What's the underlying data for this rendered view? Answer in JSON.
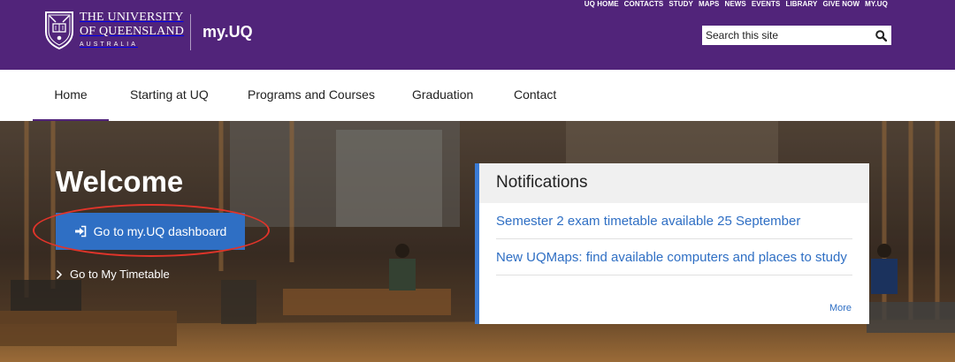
{
  "header": {
    "utility_links": [
      "UQ HOME",
      "CONTACTS",
      "STUDY",
      "MAPS",
      "NEWS",
      "EVENTS",
      "LIBRARY",
      "GIVE NOW",
      "MY.UQ"
    ],
    "logo": {
      "line1": "THE UNIVERSITY",
      "line2": "OF QUEENSLAND",
      "line3": "AUSTRALIA"
    },
    "site_name": "my.UQ",
    "search": {
      "placeholder": "Search this site",
      "value": ""
    }
  },
  "nav": {
    "items": [
      {
        "label": "Home",
        "active": true
      },
      {
        "label": "Starting at UQ"
      },
      {
        "label": "Programs and Courses"
      },
      {
        "label": "Graduation"
      },
      {
        "label": "Contact"
      }
    ]
  },
  "hero": {
    "title": "Welcome",
    "primary_button": "Go to my.UQ dashboard",
    "secondary_link": "Go to My Timetable"
  },
  "notifications": {
    "title": "Notifications",
    "items": [
      "Semester 2 exam timetable available 25 September",
      "New UQMaps: find available computers and places to study"
    ],
    "more_label": "More"
  },
  "colors": {
    "brand_purple": "#51247a",
    "link_blue": "#2f6fc4",
    "button_blue": "#2f6fc4",
    "annotation_red": "#e0342a"
  },
  "icons": {
    "search": "search-icon",
    "login": "sign-in-icon",
    "chevron": "chevron-right-icon",
    "crest": "uq-crest-icon"
  }
}
